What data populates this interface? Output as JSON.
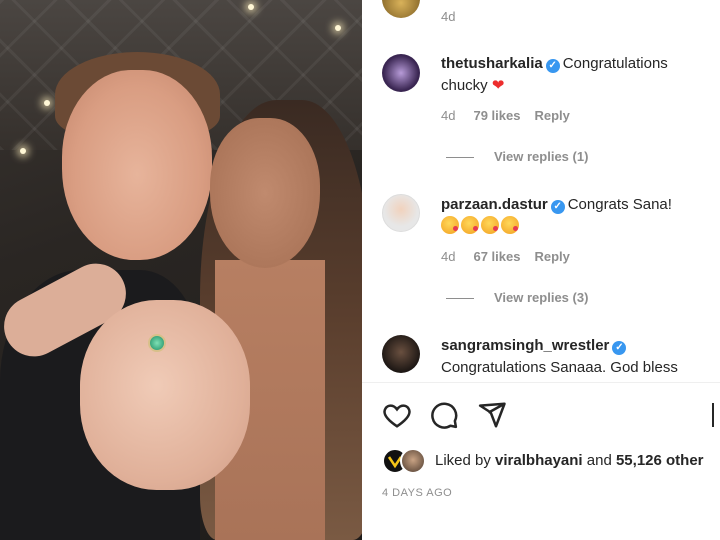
{
  "comments": {
    "top": {
      "time": "4d"
    },
    "items": [
      {
        "username": "thetusharkalia",
        "text": "Congratulations chucky",
        "emoji": "❤",
        "time": "4d",
        "likes": "79 likes",
        "reply": "Reply",
        "view_replies": "View replies (1)"
      },
      {
        "username": "parzaan.dastur",
        "text": "Congrats Sana!",
        "emoji_count": 4,
        "time": "4d",
        "likes": "67 likes",
        "reply": "Reply",
        "view_replies": "View replies (3)"
      },
      {
        "username": "sangramsingh_wrestler",
        "text": "Congratulations Sanaaa. God bless"
      }
    ]
  },
  "actions": {
    "icons": [
      "heart-outline-icon",
      "comment-bubble-icon",
      "paper-plane-icon",
      "bookmark-icon"
    ]
  },
  "liked_by": {
    "prefix": "Liked by",
    "user": "viralbhayani",
    "connector": "and",
    "others": "55,126 other"
  },
  "timestamp": "4 DAYS AGO",
  "colors": {
    "verified": "#3897f0",
    "meta": "#8e8e8e",
    "text": "#262626",
    "heart": "#ed2d2d"
  }
}
